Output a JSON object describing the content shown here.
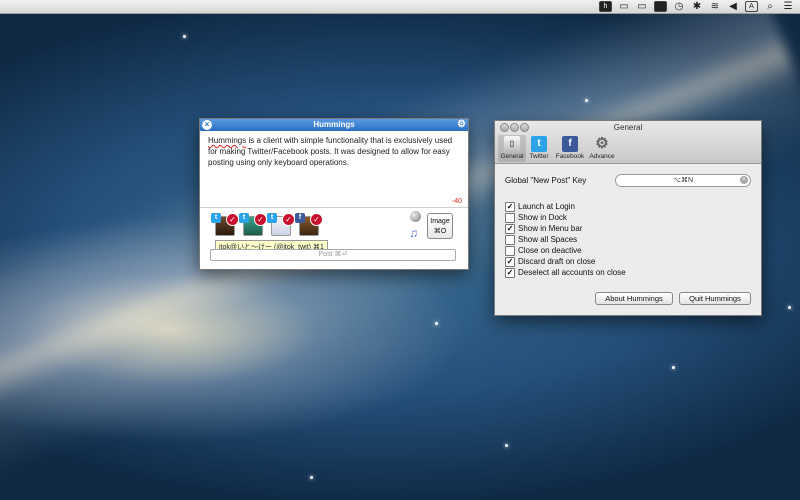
{
  "menubar": {
    "icons": [
      "hummings-icon",
      "cast-icon",
      "screen-icon",
      "battery-icon",
      "time-machine-icon",
      "bluetooth-icon",
      "wifi-icon",
      "volume-icon",
      "input-source-icon",
      "spotlight-icon",
      "notification-icon"
    ],
    "glyphs": {
      "h": "h",
      "cast": "▭",
      "screen": "▭",
      "badge": "▭",
      "tm": "◷",
      "bt": "✱",
      "wifi": "≋",
      "vol": "◀",
      "input": "A",
      "search": "⌕",
      "list": "☰"
    }
  },
  "hummings_window": {
    "title": "Hummings",
    "text_word": "Hummings",
    "text_rest": " is a client with simple functionality that is exclusively used for making Twitter/Facebook posts. It was designed to allow for easy posting using only keyboard operations.",
    "char_count": "-40",
    "tooltip": "itok@いと～けー (@itok_twit) ⌘1",
    "post_placeholder": "Post ⌘⏎",
    "image_button": {
      "line1": "Image",
      "line2": "⌘O"
    },
    "accounts": [
      {
        "service": "twitter",
        "badge": "t"
      },
      {
        "service": "twitter",
        "badge": "t"
      },
      {
        "service": "twitter",
        "badge": "t"
      },
      {
        "service": "facebook",
        "badge": "f"
      }
    ]
  },
  "general_window": {
    "title": "General",
    "tabs": [
      {
        "label": "General",
        "icon": "general-icon",
        "selected": true
      },
      {
        "label": "Twitter",
        "icon": "twitter-icon",
        "selected": false
      },
      {
        "label": "Facebook",
        "icon": "facebook-icon",
        "selected": false
      },
      {
        "label": "Advance",
        "icon": "gear-icon",
        "selected": false
      }
    ],
    "hotkey_label": "Global \"New Post\" Key",
    "hotkey_value": "⌥⌘N",
    "options": [
      {
        "label": "Launch at Login",
        "checked": true
      },
      {
        "label": "Show in Dock",
        "checked": false
      },
      {
        "label": "Show in Menu bar",
        "checked": true
      },
      {
        "label": "Show all Spaces",
        "checked": false
      },
      {
        "label": "Close on deactive",
        "checked": false
      },
      {
        "label": "Discard draft on close",
        "checked": true
      },
      {
        "label": "Deselect all accounts on close",
        "checked": true
      }
    ],
    "about_button": "About Hummings",
    "quit_button": "Quit Hummings"
  },
  "colors": {
    "twitter": "#2aa3e8",
    "facebook": "#3b5998",
    "check_red": "#c8102e",
    "title_blue": "#2b6fc1"
  }
}
